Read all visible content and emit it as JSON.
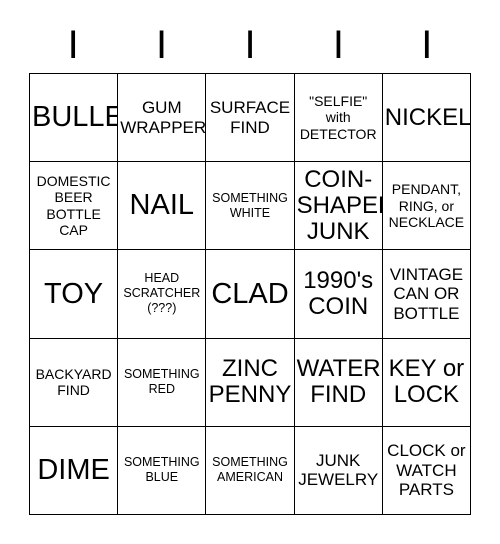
{
  "card": {
    "header_letters": [
      "I",
      "I",
      "I",
      "I",
      "I"
    ],
    "rows": [
      [
        {
          "text": "BULLET",
          "size": "xl"
        },
        {
          "text": "GUM\nWRAPPER",
          "size": "md"
        },
        {
          "text": "SURFACE\nFIND",
          "size": "md"
        },
        {
          "text": "\"SELFIE\"\nwith\nDETECTOR",
          "size": "sm"
        },
        {
          "text": "NICKEL",
          "size": "lg"
        }
      ],
      [
        {
          "text": "DOMESTIC\nBEER\nBOTTLE\nCAP",
          "size": "sm"
        },
        {
          "text": "NAIL",
          "size": "xl"
        },
        {
          "text": "SOMETHING\nWHITE",
          "size": "xs"
        },
        {
          "text": "COIN-\nSHAPED\nJUNK",
          "size": "lg"
        },
        {
          "text": "PENDANT,\nRING, or\nNECKLACE",
          "size": "sm"
        }
      ],
      [
        {
          "text": "TOY",
          "size": "xl"
        },
        {
          "text": "HEAD\nSCRATCHER\n(???)",
          "size": "xs"
        },
        {
          "text": "CLAD",
          "size": "xl"
        },
        {
          "text": "1990's\nCOIN",
          "size": "lg"
        },
        {
          "text": "VINTAGE\nCAN OR\nBOTTLE",
          "size": "md"
        }
      ],
      [
        {
          "text": "BACKYARD\nFIND",
          "size": "sm"
        },
        {
          "text": "SOMETHING\nRED",
          "size": "xs"
        },
        {
          "text": "ZINC\nPENNY",
          "size": "lg"
        },
        {
          "text": "WATER\nFIND",
          "size": "lg"
        },
        {
          "text": "KEY or\nLOCK",
          "size": "lg"
        }
      ],
      [
        {
          "text": "DIME",
          "size": "xl"
        },
        {
          "text": "SOMETHING\nBLUE",
          "size": "xs"
        },
        {
          "text": "SOMETHING\nAMERICAN",
          "size": "xs"
        },
        {
          "text": "JUNK\nJEWELRY",
          "size": "md"
        },
        {
          "text": "CLOCK or\nWATCH\nPARTS",
          "size": "md"
        }
      ]
    ]
  },
  "colors": {
    "background": "#ffffff",
    "text": "#000000",
    "border": "#000000"
  }
}
